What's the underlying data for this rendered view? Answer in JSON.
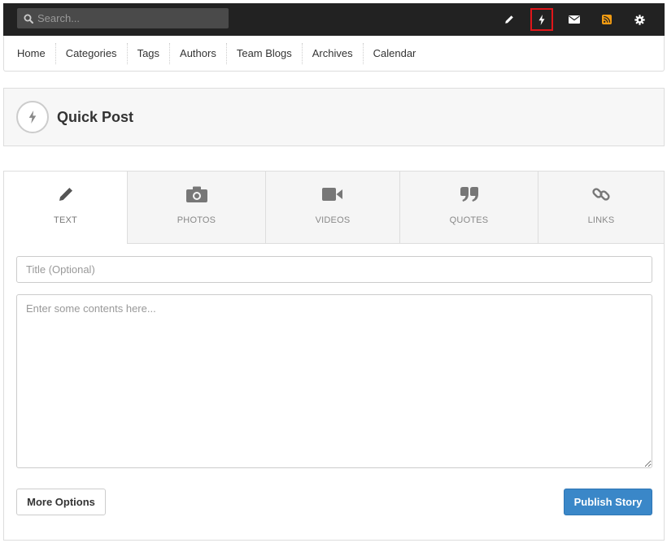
{
  "topbar": {
    "search_placeholder": "Search...",
    "icons": [
      "pencil-icon",
      "bolt-icon",
      "envelope-icon",
      "rss-icon",
      "gear-icon"
    ],
    "active_icon": "bolt-icon",
    "colors": {
      "background": "#222222",
      "rss": "#f39c12",
      "active_outline": "#e0161a"
    }
  },
  "nav": {
    "items": [
      {
        "label": "Home"
      },
      {
        "label": "Categories"
      },
      {
        "label": "Tags"
      },
      {
        "label": "Authors"
      },
      {
        "label": "Team Blogs"
      },
      {
        "label": "Archives"
      },
      {
        "label": "Calendar"
      }
    ]
  },
  "quickpost": {
    "title": "Quick Post",
    "icon": "bolt-icon"
  },
  "tabs": [
    {
      "label": "TEXT",
      "icon": "pencil-icon",
      "active": true
    },
    {
      "label": "PHOTOS",
      "icon": "camera-icon",
      "active": false
    },
    {
      "label": "VIDEOS",
      "icon": "video-camera-icon",
      "active": false
    },
    {
      "label": "QUOTES",
      "icon": "quote-icon",
      "active": false
    },
    {
      "label": "LINKS",
      "icon": "link-icon",
      "active": false
    }
  ],
  "form": {
    "title_placeholder": "Title (Optional)",
    "title_value": "",
    "content_placeholder": "Enter some contents here...",
    "content_value": "",
    "more_options_label": "More Options",
    "publish_label": "Publish Story",
    "publish_color": "#3a87c8"
  }
}
